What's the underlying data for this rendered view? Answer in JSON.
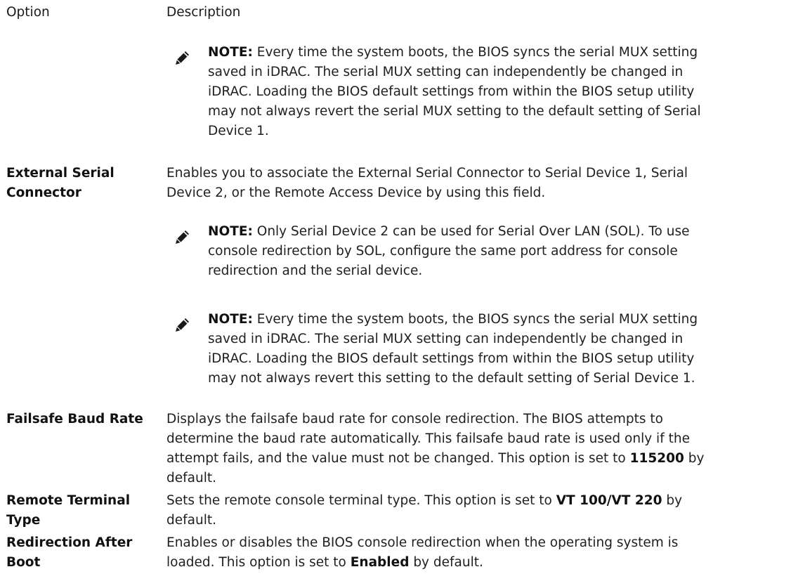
{
  "header": {
    "option": "Option",
    "description": "Description"
  },
  "note_label": "NOTE:",
  "notes": [
    {
      "lines": [
        " Every time the system boots, the BIOS syncs the serial MUX setting",
        "saved in iDRAC. The serial MUX setting can independently be changed in",
        "iDRAC. Loading the BIOS default settings from within the BIOS setup utility",
        "may not always revert the serial MUX setting to the default setting of Serial",
        "Device 1."
      ]
    },
    {
      "lines": [
        " Only Serial Device 2 can be used for Serial Over LAN (SOL). To use",
        "console redirection by SOL, configure the same port address for console",
        "redirection and the serial device."
      ]
    },
    {
      "lines": [
        " Every time the system boots, the BIOS syncs the serial MUX setting",
        "saved in iDRAC. The serial MUX setting can independently be changed in",
        "iDRAC. Loading the BIOS default settings from within the BIOS setup utility",
        "may not always revert this setting to the default setting of Serial Device 1."
      ]
    }
  ],
  "rows": [
    {
      "option_lines": [
        "External Serial",
        "Connector"
      ],
      "desc_lines": [
        "Enables you to associate the External Serial Connector to Serial Device 1, Serial",
        "Device 2, or the Remote Access Device by using this field."
      ]
    },
    {
      "option_lines": [
        "Failsafe Baud Rate"
      ],
      "desc_lines": [
        "Displays the failsafe baud rate for console redirection. The BIOS attempts to",
        "determine the baud rate automatically. This failsafe baud rate is used only if the",
        "attempt fails, and the value must not be changed. This option is set to ",
        "default."
      ],
      "bold_value": "115200",
      "after_bold": " by"
    },
    {
      "option_lines": [
        "Remote Terminal",
        "Type"
      ],
      "desc_before": "Sets the remote console terminal type. This option is set to ",
      "bold_value": "VT 100/VT 220",
      "desc_after": " by",
      "desc_line2": "default."
    },
    {
      "option_lines": [
        "Redirection After",
        "Boot"
      ],
      "desc_line1": "Enables or disables the BIOS console redirection when the operating system is",
      "desc_before": "loaded. This option is set to ",
      "bold_value": "Enabled",
      "desc_after": " by default."
    }
  ]
}
